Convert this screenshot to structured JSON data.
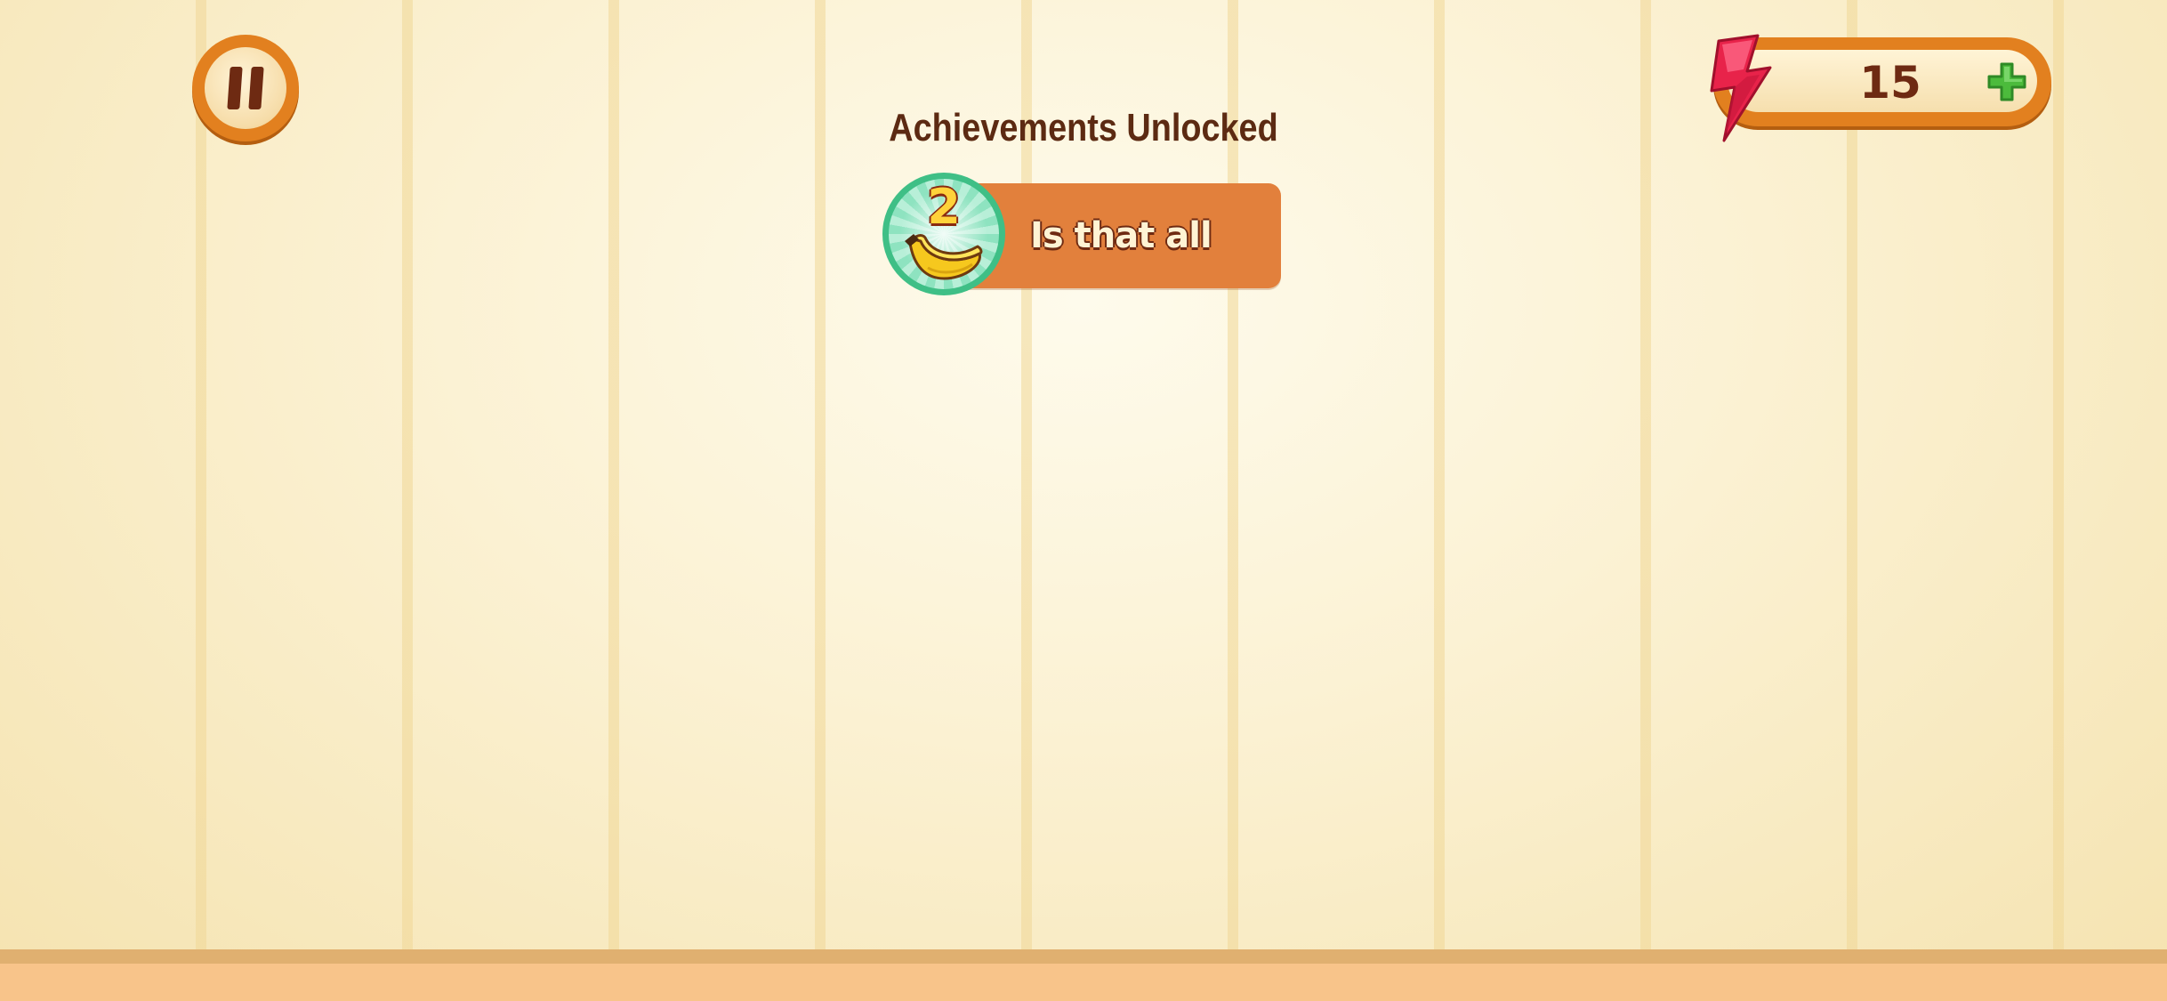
{
  "hud": {
    "currency_value": "15"
  },
  "achievements": {
    "title": "Achievements Unlocked",
    "items": [
      {
        "label": "Is that all",
        "level": "2",
        "icon": "banana-icon"
      }
    ]
  },
  "icons": {
    "pause": "pause-icon",
    "energy": "lightning-bolt-icon",
    "add": "plus-icon"
  },
  "colors": {
    "accent_orange": "#e2801f",
    "card_orange": "#e2803c",
    "text_brown": "#5c2a12",
    "badge_green": "#3fbf86",
    "bolt_red": "#e8234a",
    "plus_green": "#4cbb3c"
  }
}
